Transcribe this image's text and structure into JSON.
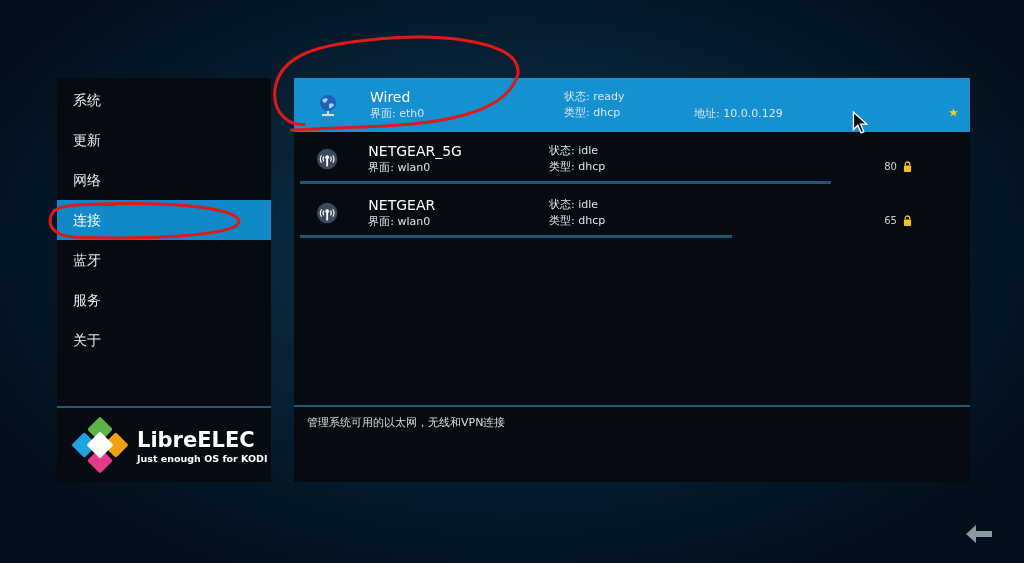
{
  "sidebar": {
    "items": [
      {
        "label": "系统",
        "selected": false
      },
      {
        "label": "更新",
        "selected": false
      },
      {
        "label": "网络",
        "selected": false
      },
      {
        "label": "连接",
        "selected": true
      },
      {
        "label": "蓝牙",
        "selected": false
      },
      {
        "label": "服务",
        "selected": false
      },
      {
        "label": "关于",
        "selected": false
      }
    ],
    "logo": {
      "name": "LibreELEC",
      "tagline": "Just enough OS for KODI"
    }
  },
  "connections": [
    {
      "kind": "wired",
      "name": "Wired",
      "selected": true,
      "interface": "界面: eth0",
      "state": "状态: ready",
      "type": "类型: dhcp",
      "address": "地址: 10.0.0.129",
      "favorite": true
    },
    {
      "kind": "wifi",
      "name": "NETGEAR_5G",
      "selected": false,
      "interface": "界面: wlan0",
      "state": "状态: idle",
      "type": "类型: dhcp",
      "strength": "80",
      "level": 0.8,
      "locked": true
    },
    {
      "kind": "wifi",
      "name": "NETGEAR",
      "selected": false,
      "interface": "界面: wlan0",
      "state": "状态: idle",
      "type": "类型: dhcp",
      "strength": "65",
      "level": 0.65,
      "locked": true
    }
  ],
  "description": "管理系统可用的以太网，无线和VPN连接"
}
